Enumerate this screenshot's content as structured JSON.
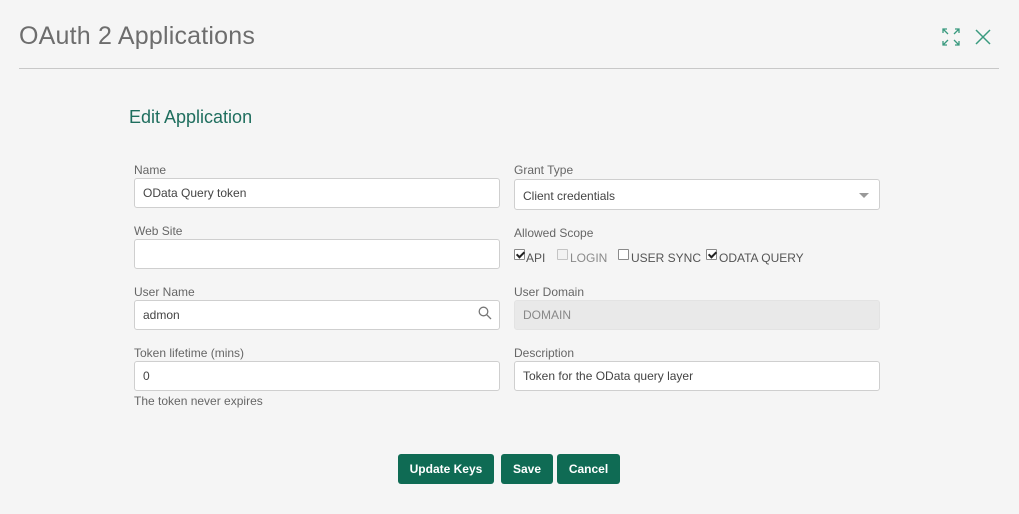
{
  "window": {
    "title": "OAuth 2 Applications"
  },
  "form": {
    "heading": "Edit Application",
    "name": {
      "label": "Name",
      "value": "OData Query token"
    },
    "website": {
      "label": "Web Site",
      "value": ""
    },
    "username": {
      "label": "User Name",
      "value": "admon"
    },
    "token_lifetime": {
      "label": "Token lifetime (mins)",
      "value": "0",
      "hint": "The token never expires"
    },
    "grant_type": {
      "label": "Grant Type",
      "value": "Client credentials"
    },
    "allowed_scope": {
      "label": "Allowed Scope",
      "options": [
        {
          "label": "API",
          "checked": true,
          "disabled": false
        },
        {
          "label": "LOGIN",
          "checked": false,
          "disabled": true
        },
        {
          "label": "USER SYNC",
          "checked": false,
          "disabled": false
        },
        {
          "label": "ODATA QUERY",
          "checked": true,
          "disabled": false
        }
      ]
    },
    "user_domain": {
      "label": "User Domain",
      "value": "DOMAIN"
    },
    "description": {
      "label": "Description",
      "value": "Token for the OData query layer"
    }
  },
  "buttons": {
    "update_keys": "Update Keys",
    "save": "Save",
    "cancel": "Cancel"
  },
  "icons": {
    "expand": "expand-icon",
    "close": "close-icon",
    "search": "search-icon"
  },
  "colors": {
    "accent": "#0f6b54",
    "heading": "#1f6e5e",
    "background": "#f5f5f5"
  }
}
